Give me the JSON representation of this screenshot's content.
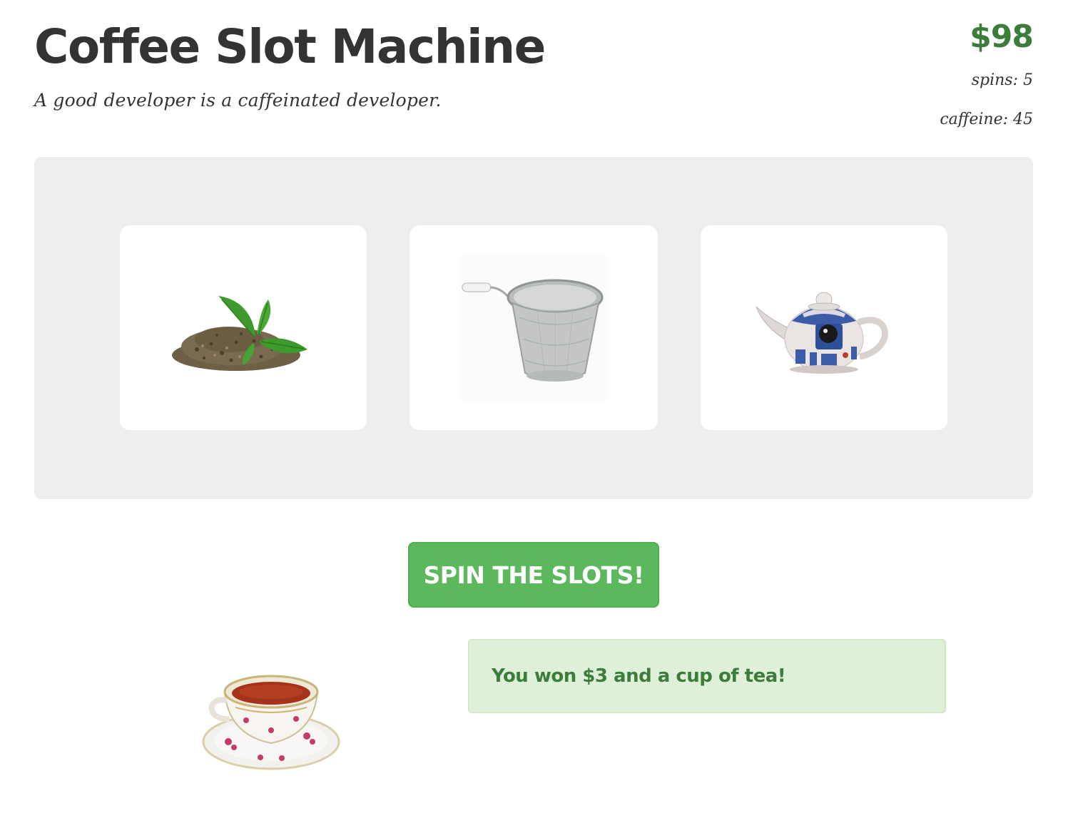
{
  "header": {
    "title": "Coffee Slot Machine",
    "tagline": "A good developer is a caffeinated developer."
  },
  "stats": {
    "money": "$98",
    "spins": "spins: 5",
    "caffeine": "caffeine: 45"
  },
  "slots": [
    {
      "item": "tea-leaves-icon"
    },
    {
      "item": "tea-strainer-icon"
    },
    {
      "item": "r2d2-teapot-icon"
    }
  ],
  "controls": {
    "spin_label": "SPIN THE SLOTS!"
  },
  "result": {
    "prize_icon": "teacup-icon",
    "message": "You won $3 and a cup of tea!"
  },
  "colors": {
    "accent_green": "#5cb85c",
    "money_green": "#3c7d3c",
    "panel_gray": "#eeeeee",
    "alert_bg": "#dff0d8"
  }
}
